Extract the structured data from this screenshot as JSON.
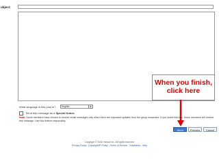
{
  "form": {
    "subject_label": "ubject:",
    "language_label": "What language is this post in?",
    "language_value": "English",
    "special_notice_prefix": "Send this message as a ",
    "special_notice_emph": "Special Notice",
    "note_label": "Note:",
    "note_text": "Some members have chosen to receive email messages only when there are important updates from the group moderator. If you select this box, those members will receive this message. Use this feature responsibly."
  },
  "callout": {
    "line1": "When you finish,",
    "line2": "click here"
  },
  "buttons": {
    "send": "Send",
    "preview": "Preview",
    "cancel": "Cancel"
  },
  "footer": {
    "copyright": "Copyright © 2006 Yahoo! Inc. All rights reserved.",
    "links": "Privacy Policy - Copyright/IP Policy - Terms of Service - Guidelines - Help"
  },
  "colors": {
    "callout_text": "#e00000",
    "arrow": "#e00000",
    "send_button": "#3d78cc"
  }
}
